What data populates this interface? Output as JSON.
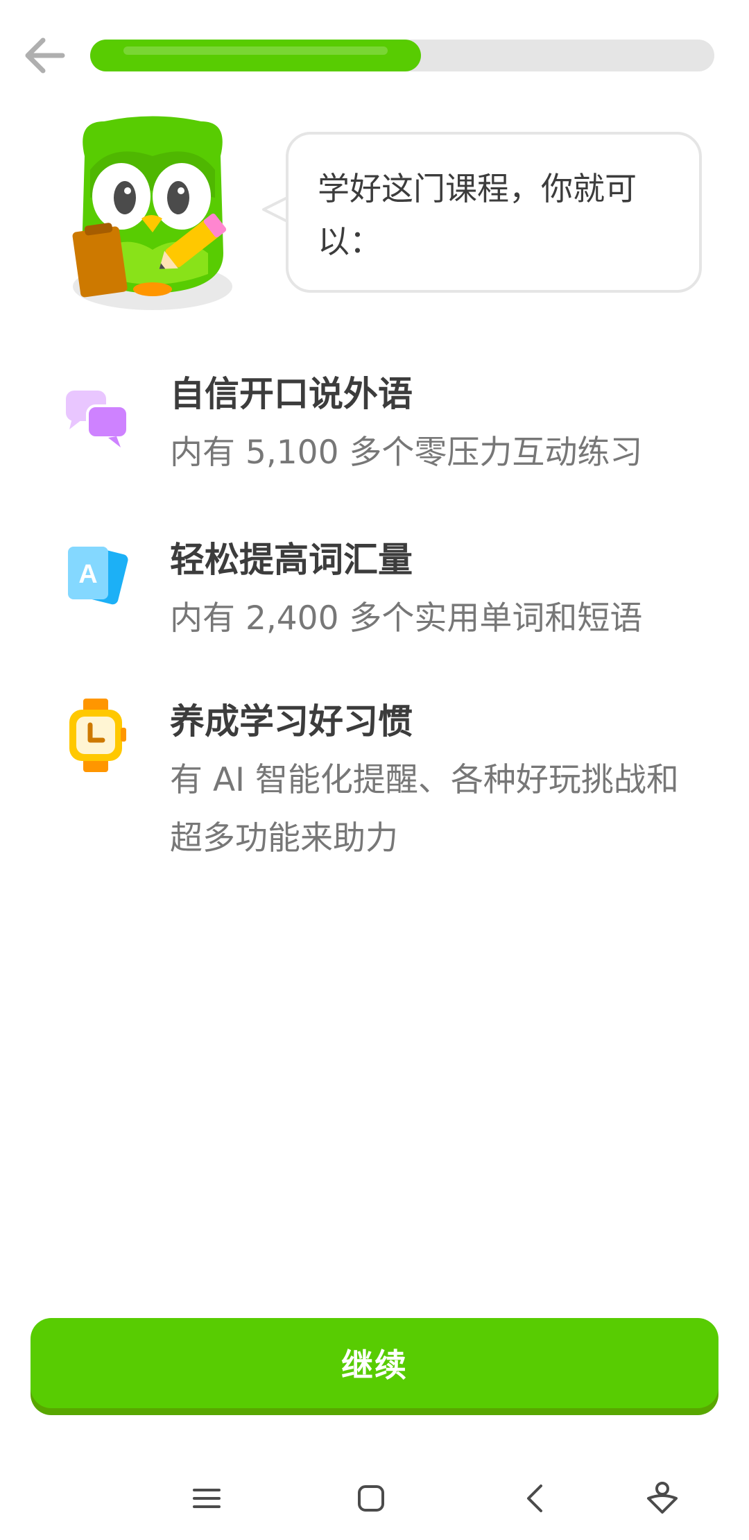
{
  "progress": {
    "fraction": 0.53,
    "color": "#58cc02",
    "track_color": "#e5e5e5"
  },
  "header": {
    "back_icon": "arrow-left-icon"
  },
  "mascot": {
    "icon": "owl-mascot-icon"
  },
  "speech_bubble": {
    "text": "学好这门课程，你就可以："
  },
  "features": [
    {
      "icon": "speech-bubbles-icon",
      "title": "自信开口说外语",
      "description": "内有 5,100 多个零压力互动练习"
    },
    {
      "icon": "flashcards-icon",
      "title": "轻松提高词汇量",
      "description": "内有 2,400 多个实用单词和短语"
    },
    {
      "icon": "watch-icon",
      "title": "养成学习好习惯",
      "description": "有 AI 智能化提醒、各种好玩挑战和超多功能来助力"
    }
  ],
  "footer": {
    "continue_label": "继续",
    "button_color": "#58cc02"
  },
  "system_nav": {
    "icons": [
      "menu-icon",
      "home-icon",
      "back-icon",
      "assistant-icon"
    ]
  }
}
